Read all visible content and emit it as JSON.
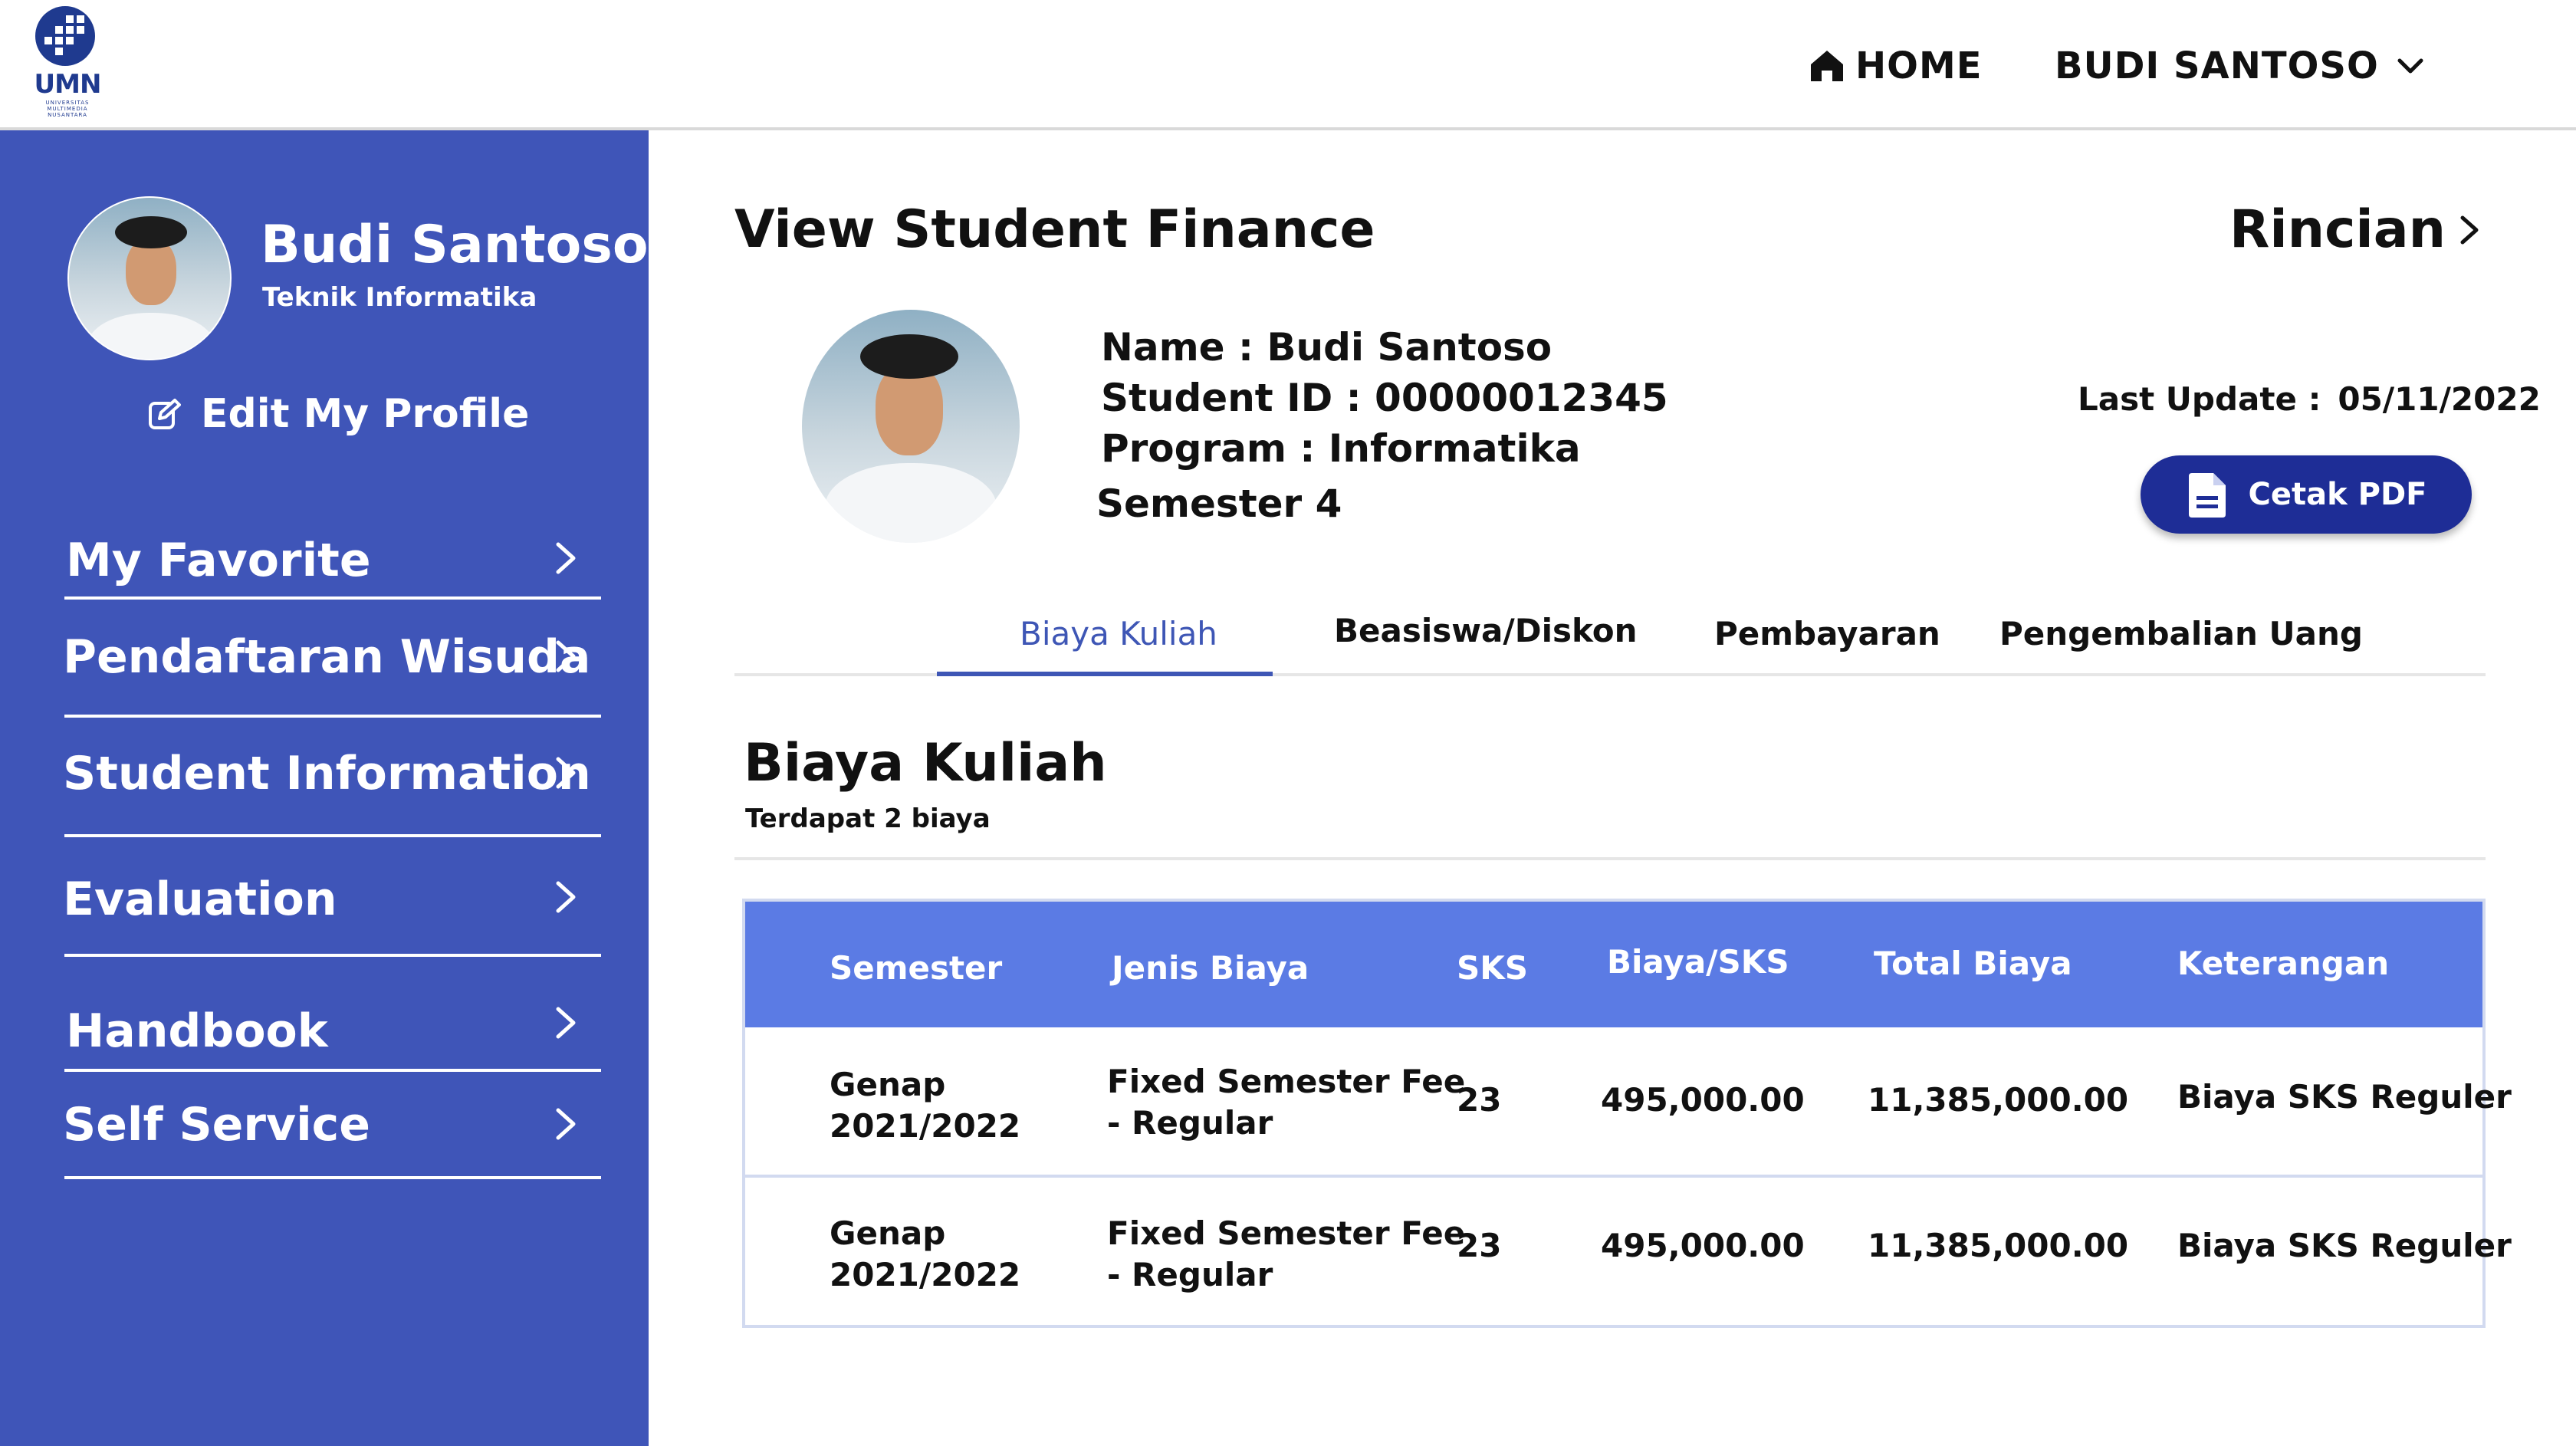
{
  "header": {
    "logo": {
      "name": "UMN",
      "subtitle": "UNIVERSITAS MULTIMEDIA NUSANTARA"
    },
    "home_label": "HOME",
    "user_label": "BUDI SANTOSO"
  },
  "sidebar": {
    "profile": {
      "name": "Budi Santoso",
      "program": "Teknik Informatika"
    },
    "edit_profile_label": "Edit My Profile",
    "menu": [
      {
        "label": "My Favorite"
      },
      {
        "label": "Pendaftaran Wisuda"
      },
      {
        "label": "Student Information"
      },
      {
        "label": "Evaluation"
      },
      {
        "label": "Handbook"
      },
      {
        "label": "Self Service"
      }
    ]
  },
  "main": {
    "title": "View Student Finance",
    "rincian_label": "Rincian",
    "student": {
      "name": "Name : Budi Santoso",
      "id": "Student ID : 00000012345",
      "program": "Program : Informatika",
      "semester": "Semester 4"
    },
    "last_update": {
      "label": "Last Update :",
      "date": "05/11/2022"
    },
    "pdf_button": "Cetak PDF",
    "tabs": [
      {
        "label": "Biaya Kuliah",
        "active": true
      },
      {
        "label": "Beasiswa/Diskon",
        "active": false
      },
      {
        "label": "Pembayaran",
        "active": false
      },
      {
        "label": "Pengembalian Uang",
        "active": false
      }
    ],
    "section": {
      "title": "Biaya Kuliah",
      "subtitle": "Terdapat 2 biaya"
    },
    "table": {
      "columns": [
        "Semester",
        "Jenis Biaya",
        "SKS",
        "Biaya/SKS",
        "Total Biaya",
        "Keterangan"
      ],
      "rows": [
        {
          "semester": [
            "Genap",
            "2021/2022"
          ],
          "jenis": [
            "Fixed Semester Fee",
            "- Regular"
          ],
          "sks": "23",
          "biaya_sks": "495,000.00",
          "total": "11,385,000.00",
          "keterangan": "Biaya SKS Reguler"
        },
        {
          "semester": [
            "Genap",
            "2021/2022"
          ],
          "jenis": [
            "Fixed Semester Fee",
            "- Regular"
          ],
          "sks": "23",
          "biaya_sks": "495,000.00",
          "total": "11,385,000.00",
          "keterangan": "Biaya SKS Reguler"
        }
      ]
    }
  },
  "colors": {
    "sidebar_bg": "#3f55b8",
    "accent": "#3e56b5",
    "table_header": "#5b7be4",
    "pdf_button": "#1e2d96"
  },
  "icons": [
    "home-icon",
    "chevron-down-icon",
    "edit-icon",
    "chevron-right-icon",
    "document-icon"
  ]
}
